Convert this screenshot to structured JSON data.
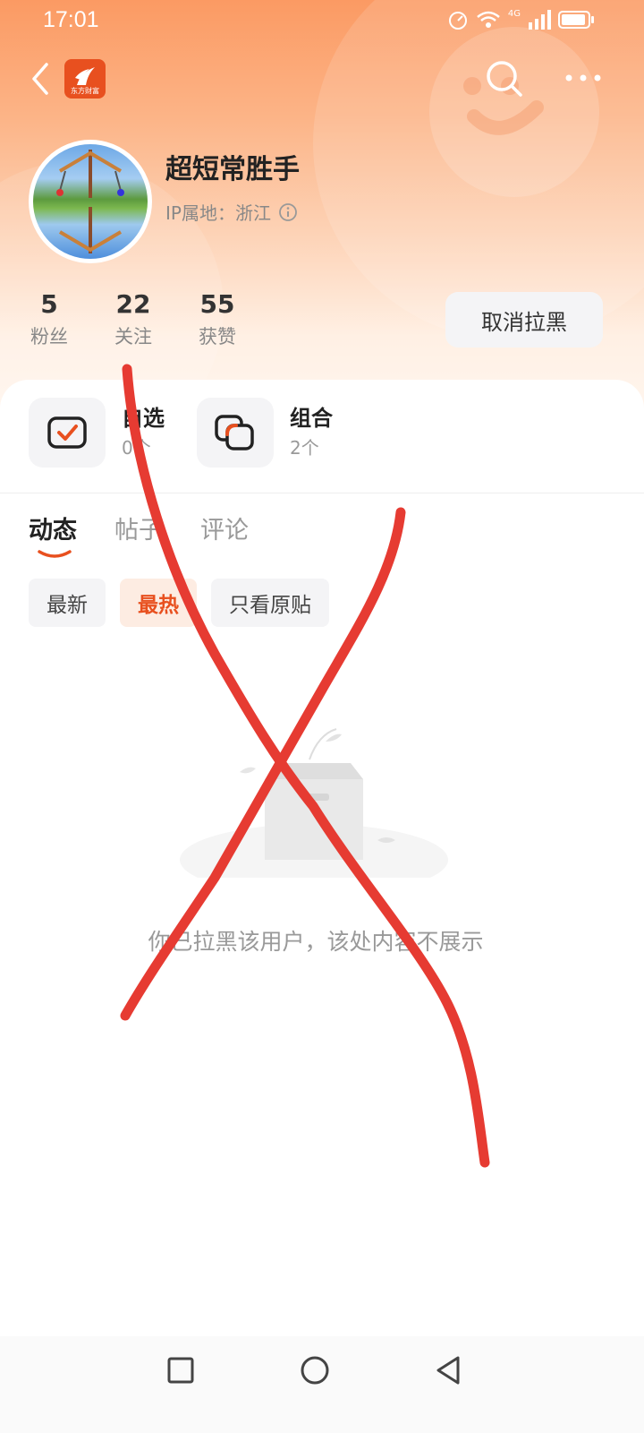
{
  "status_bar": {
    "time": "17:01",
    "network": "4G"
  },
  "header": {
    "app_logo_text": "东方财富",
    "back_icon": "chevron-left-icon",
    "search_icon": "search-icon",
    "more_icon": "more-dots-icon"
  },
  "profile": {
    "username": "超短常胜手",
    "ip_location": "IP属地：浙江",
    "stats": [
      {
        "value": "5",
        "label": "粉丝"
      },
      {
        "value": "22",
        "label": "关注"
      },
      {
        "value": "55",
        "label": "获赞"
      }
    ],
    "unblock_label": "取消拉黑"
  },
  "quick_links": [
    {
      "title": "自选",
      "count": "0个",
      "icon": "checkbox-icon"
    },
    {
      "title": "组合",
      "count": "2个",
      "icon": "stacked-squares-icon"
    }
  ],
  "tabs": [
    {
      "label": "动态",
      "active": true
    },
    {
      "label": "帖子",
      "active": false
    },
    {
      "label": "评论",
      "active": false
    }
  ],
  "filters": [
    {
      "label": "最新",
      "active": false
    },
    {
      "label": "最热",
      "active": true
    },
    {
      "label": "只看原贴",
      "active": false
    }
  ],
  "empty_state": {
    "message": "你已拉黑该用户，该处内容不展示"
  },
  "colors": {
    "accent": "#e8501f",
    "header_top": "#fb9a63",
    "overlay_mark": "#e63b32"
  }
}
